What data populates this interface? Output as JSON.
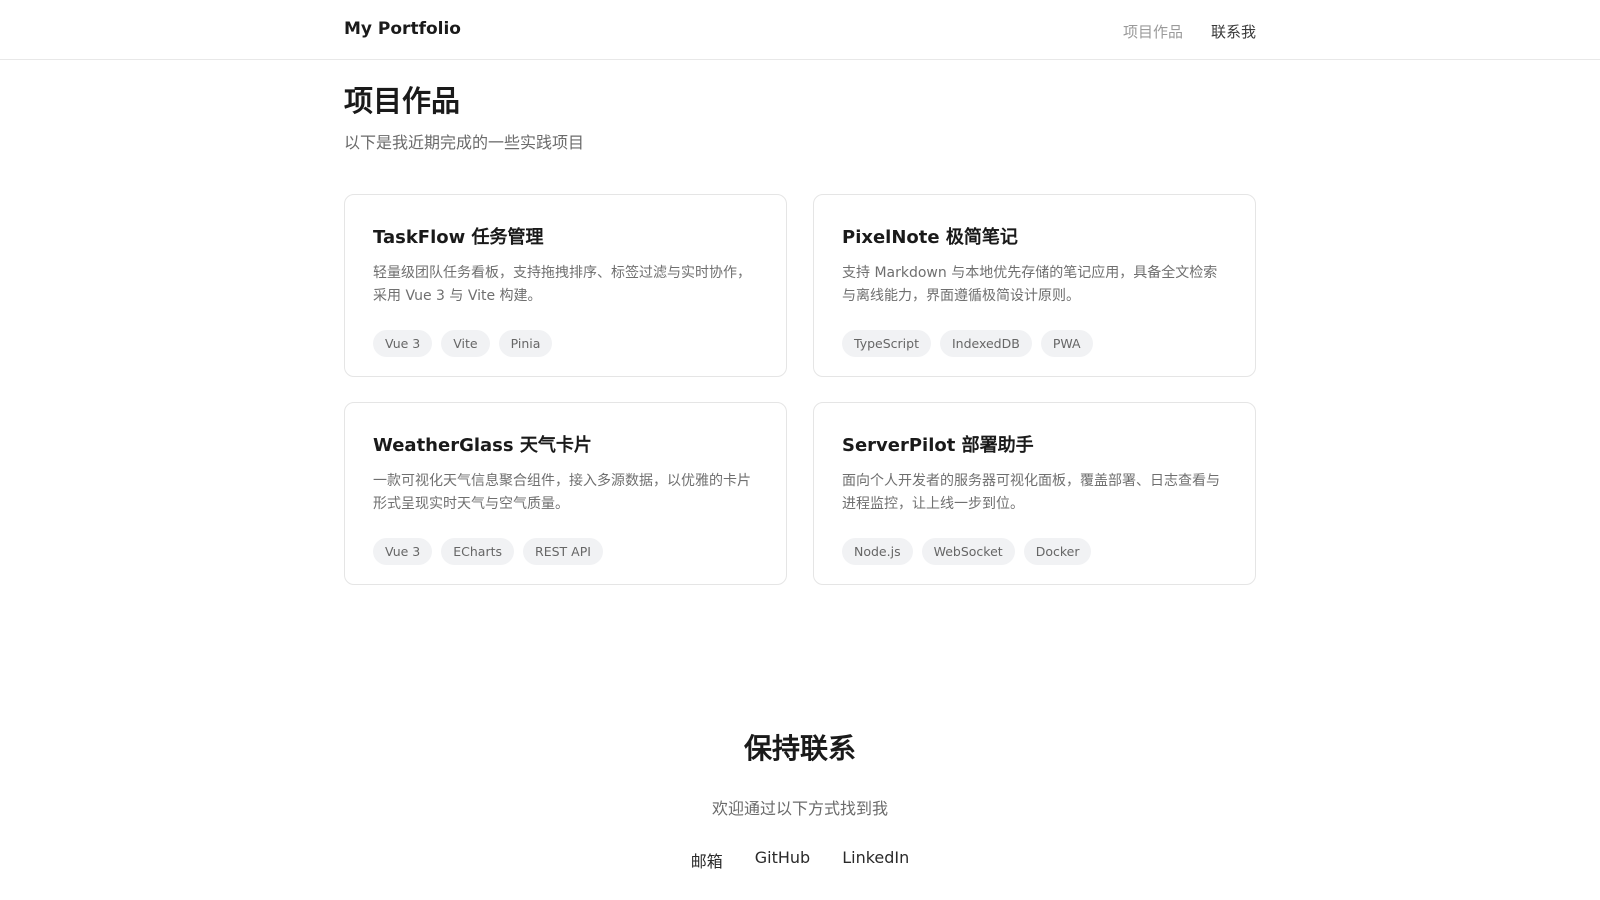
{
  "header": {
    "brand": "My Portfolio",
    "nav": [
      {
        "label": "项目作品"
      },
      {
        "label": "联系我"
      }
    ]
  },
  "projects_section": {
    "title": "项目作品",
    "subtitle": "以下是我近期完成的一些实践项目",
    "cards": [
      {
        "title": "TaskFlow 任务管理",
        "description": "轻量级团队任务看板，支持拖拽排序、标签过滤与实时协作，采用 Vue 3 与 Vite 构建。",
        "tags": [
          "Vue 3",
          "Vite",
          "Pinia"
        ]
      },
      {
        "title": "PixelNote 极简笔记",
        "description": "支持 Markdown 与本地优先存储的笔记应用，具备全文检索与离线能力，界面遵循极简设计原则。",
        "tags": [
          "TypeScript",
          "IndexedDB",
          "PWA"
        ]
      },
      {
        "title": "WeatherGlass 天气卡片",
        "description": "一款可视化天气信息聚合组件，接入多源数据，以优雅的卡片形式呈现实时天气与空气质量。",
        "tags": [
          "Vue 3",
          "ECharts",
          "REST API"
        ]
      },
      {
        "title": "ServerPilot 部署助手",
        "description": "面向个人开发者的服务器可视化面板，覆盖部署、日志查看与进程监控，让上线一步到位。",
        "tags": [
          "Node.js",
          "WebSocket",
          "Docker"
        ]
      }
    ]
  },
  "contact_section": {
    "title": "保持联系",
    "subtitle": "欢迎通过以下方式找到我",
    "links": [
      {
        "label": "邮箱"
      },
      {
        "label": "GitHub"
      },
      {
        "label": "LinkedIn"
      }
    ]
  }
}
